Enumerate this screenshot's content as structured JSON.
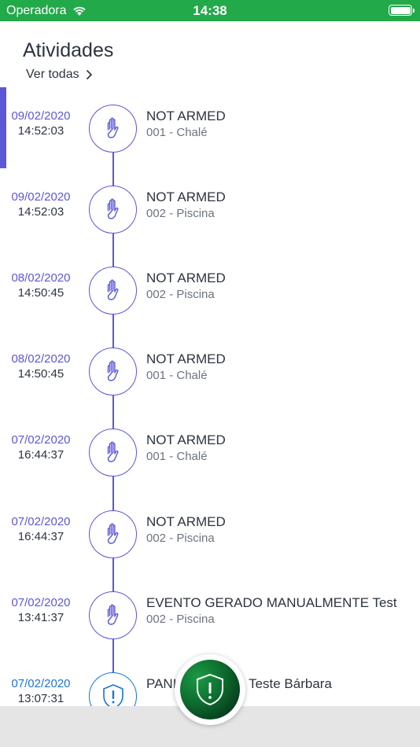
{
  "status_bar": {
    "carrier": "Operadora",
    "time": "14:38",
    "icons": [
      "wifi-icon",
      "battery-icon"
    ],
    "battery_level": 1.0
  },
  "header": {
    "title": "Atividades",
    "see_all_label": "Ver todas",
    "see_all_icon": "chevron-right-icon"
  },
  "colors": {
    "status_bar_bg": "#22a94a",
    "accent": "#5b57d6",
    "panic_accent": "#1a73d9",
    "text_primary": "#2b3440",
    "text_secondary": "#6b7480",
    "bottom_bar_bg": "#e5e5e5"
  },
  "activities": [
    {
      "date": "09/02/2020",
      "time": "14:52:03",
      "title": "NOT ARMED",
      "subtitle": "001 - Chalé",
      "icon": "hand-icon",
      "selected": true
    },
    {
      "date": "09/02/2020",
      "time": "14:52:03",
      "title": "NOT ARMED",
      "subtitle": "002 - Piscina",
      "icon": "hand-icon"
    },
    {
      "date": "08/02/2020",
      "time": "14:50:45",
      "title": "NOT ARMED",
      "subtitle": "002 - Piscina",
      "icon": "hand-icon"
    },
    {
      "date": "08/02/2020",
      "time": "14:50:45",
      "title": "NOT ARMED",
      "subtitle": "001 - Chalé",
      "icon": "hand-icon"
    },
    {
      "date": "07/02/2020",
      "time": "16:44:37",
      "title": "NOT ARMED",
      "subtitle": "001 - Chalé",
      "icon": "hand-icon"
    },
    {
      "date": "07/02/2020",
      "time": "16:44:37",
      "title": "NOT ARMED",
      "subtitle": "002 - Piscina",
      "icon": "hand-icon"
    },
    {
      "date": "07/02/2020",
      "time": "13:41:37",
      "title": "EVENTO GERADO MANUALMENTE Test",
      "subtitle": "002 - Piscina",
      "icon": "hand-icon"
    },
    {
      "date": "07/02/2020",
      "time": "13:07:31",
      "title": "PANI",
      "title_suffix": "- Teste Bárbara",
      "subtitle": "",
      "icon": "alert-shield-icon"
    }
  ],
  "panic_button": {
    "icon": "shield-alert-icon"
  }
}
